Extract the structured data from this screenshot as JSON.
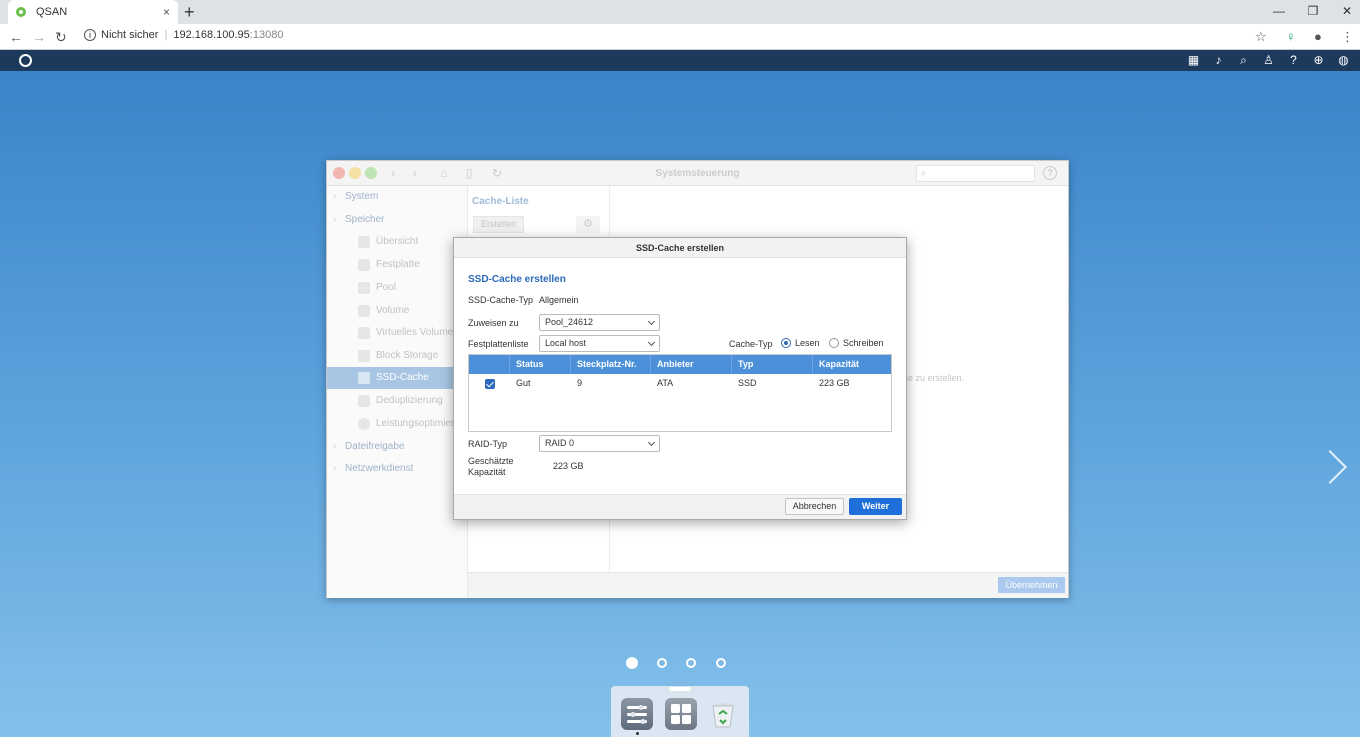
{
  "browser": {
    "tab_title": "QSAN",
    "tab_close": "×",
    "new_tab": "+",
    "security": "Nicht sicher",
    "url_host": "192.168.100.95",
    "url_port": ":13080"
  },
  "control_panel": {
    "title": "Systemsteuerung",
    "help": "?",
    "sidebar": {
      "system": "System",
      "storage": "Speicher",
      "items": [
        "Übersicht",
        "Festplatte",
        "Pool",
        "Volume",
        "Virtuelles Volume",
        "Block Storage",
        "SSD-Cache",
        "Deduplizierung",
        "Leistungsoptimierung"
      ],
      "file_sharing": "Dateifreigabe",
      "network": "Netzwerkdienst"
    },
    "cache_list_title": "Cache-Liste",
    "create_button": "Erstellen",
    "empty_hint": "ne zu erstellen.",
    "apply_button": "Übernehmen"
  },
  "modal": {
    "title": "SSD-Cache erstellen",
    "heading": "SSD-Cache erstellen",
    "cache_type_label": "SSD-Cache-Typ",
    "cache_type_value": "Allgemein",
    "assign_label": "Zuweisen zu",
    "assign_value": "Pool_24612",
    "disk_list_label": "Festplattenliste",
    "disk_list_value": "Local host",
    "cache_mode_label": "Cache-Typ",
    "read_label": "Lesen",
    "write_label": "Schreiben",
    "table": {
      "headers": [
        "Status",
        "Steckplatz-Nr.",
        "Anbieter",
        "Typ",
        "Kapazität"
      ],
      "rows": [
        [
          "Gut",
          "9",
          "ATA",
          "SSD",
          "223 GB"
        ]
      ]
    },
    "raid_label": "RAID-Typ",
    "raid_value": "RAID 0",
    "capacity_label_1": "Geschätzte",
    "capacity_label_2": "Kapazität",
    "capacity_value": "223 GB",
    "cancel_button": "Abbrechen",
    "next_button": "Weiter"
  },
  "colors": {
    "accent": "#2c69b8",
    "primary_button": "#1e6fd9",
    "table_header": "#4b90d9",
    "topbar": "#1d3a5d"
  }
}
